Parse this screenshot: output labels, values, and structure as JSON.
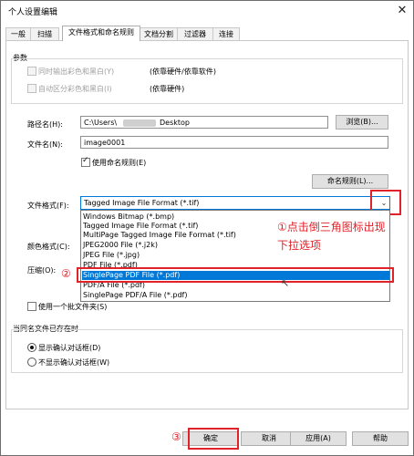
{
  "window": {
    "title": "个人设置编辑",
    "close_glyph": "✕"
  },
  "tabs": [
    {
      "label": "一般"
    },
    {
      "label": "扫描"
    },
    {
      "label": "文件格式和命名规则"
    },
    {
      "label": "文档分割"
    },
    {
      "label": "过滤器"
    },
    {
      "label": "连接"
    }
  ],
  "params": {
    "group_label": "参数",
    "color_out_label": "同时输出彩色和黑白(Y)",
    "color_out_hint": "(依靠硬件/依靠软件)",
    "auto_color_label": "自动区分彩色和黑白(I)",
    "auto_color_hint": "(依靠硬件)"
  },
  "path": {
    "label": "路径名(H):",
    "value": "C:\\Users\\",
    "value_tail": "Desktop",
    "browse_label": "浏览(B)..."
  },
  "filename": {
    "label": "文件名(N):",
    "value": "image0001",
    "use_rule_label": "使用命名规则(E)",
    "rule_button_label": "命名规则(L)..."
  },
  "format": {
    "label": "文件格式(F):",
    "selected": "Tagged Image File Format (*.tif)",
    "options": [
      "Windows Bitmap (*.bmp)",
      "Tagged Image File Format (*.tif)",
      "MultiPage Tagged Image File Format (*.tif)",
      "JPEG2000 File (*.j2k)",
      "JPEG File (*.jpg)",
      "PDF File (*.pdf)",
      "SinglePage PDF File (*.pdf)",
      "PDF/A File (*.pdf)",
      "SinglePage PDF/A File (*.pdf)"
    ],
    "highlighted_index": 6
  },
  "color_format_label": "颜色格式(C):",
  "compression_label": "压缩(O):",
  "batch_label": "使用一个批文件夹(S)",
  "exists": {
    "group_label": "当同名文件已存在时",
    "opt_show": "显示确认对话框(D)",
    "opt_noshow": "不显示确认对话框(W)"
  },
  "footer": {
    "ok": "确定",
    "cancel": "取消",
    "apply": "应用(A)",
    "help": "帮助"
  },
  "annotations": {
    "step1_line1": "①点击倒三角图标出现",
    "step1_line2": "下拉选项",
    "step2": "②",
    "step3": "③"
  },
  "colors": {
    "accent": "#0078d7",
    "annotation_red": "#e0222a"
  }
}
